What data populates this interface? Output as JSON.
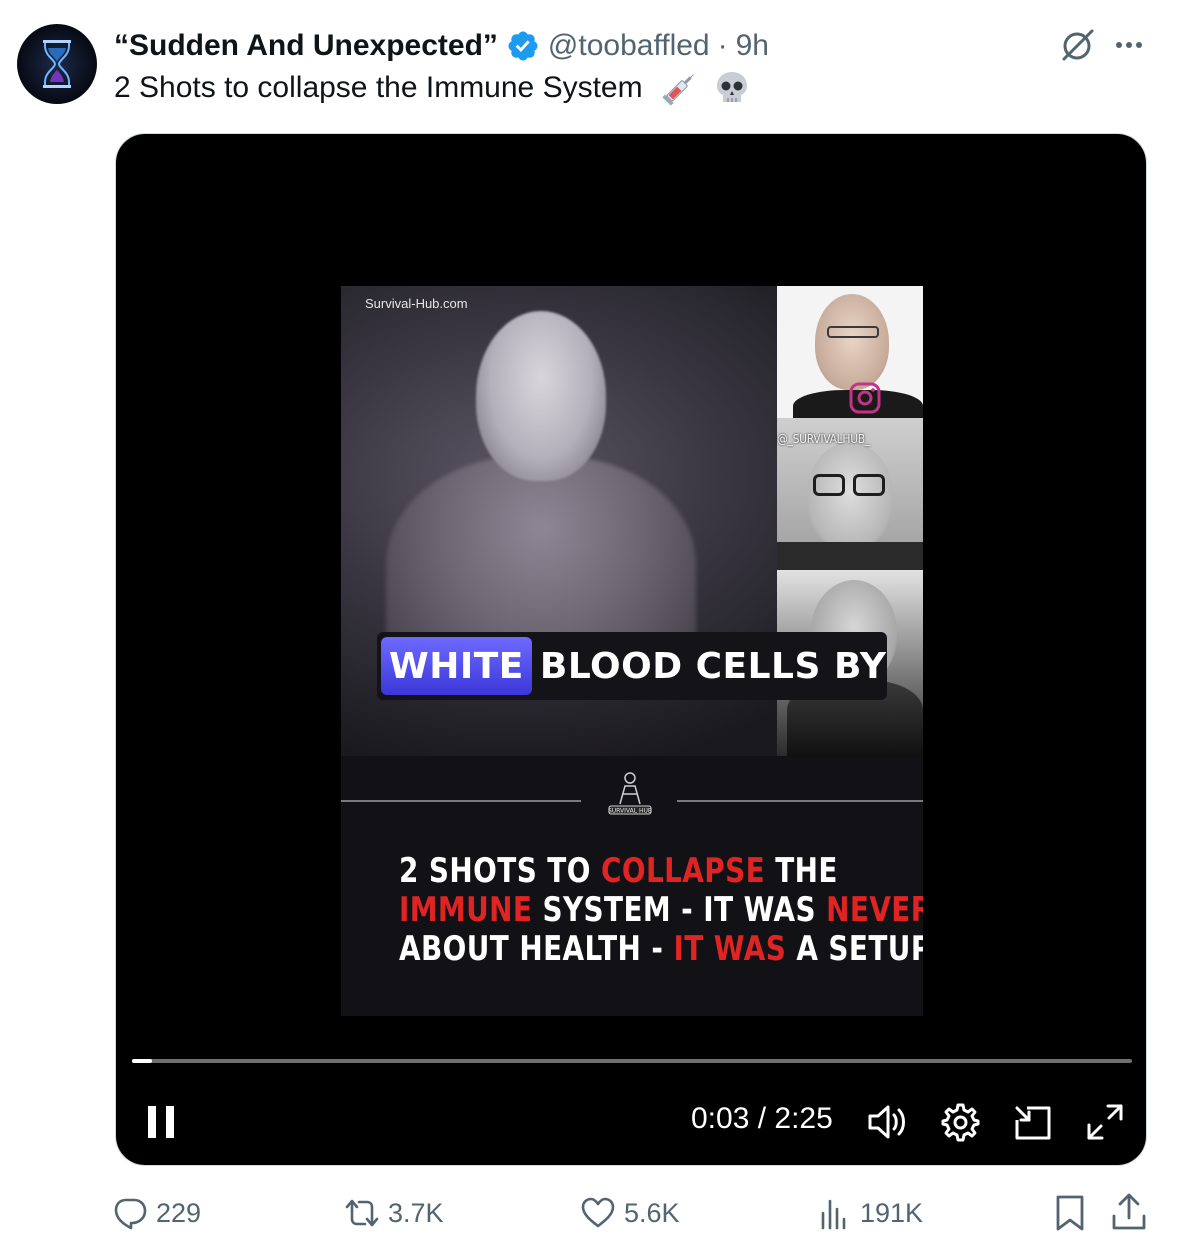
{
  "author": {
    "display_name": "“Sudden And Unexpected”",
    "handle": "@toobaffled",
    "separator": "·",
    "time_ago": "9h",
    "verified": true
  },
  "tweet": {
    "text": "2 Shots to collapse the Immune System",
    "emojis": [
      "syringe-emoji",
      "skull-emoji"
    ]
  },
  "video_frame": {
    "site_label": "Survival-Hub.com",
    "watermark": "@_SURVIVALHUB_",
    "caption_highlight": "WHITE",
    "caption_rest": "BLOOD CELLS BY",
    "logo_text": "SURVIVAL HUB",
    "headline": {
      "line1": [
        "2 SHOTS TO ",
        "COLLAPSE",
        " THE"
      ],
      "line2": [
        "IMMUNE",
        " SYSTEM - IT WAS ",
        "NEVER"
      ],
      "line3": [
        "ABOUT HEALTH - ",
        "IT WAS",
        " A SETUP"
      ]
    }
  },
  "player": {
    "current_time": "0:03",
    "duration": "2:25",
    "time_display": "0:03 / 2:25",
    "progress_fraction": 0.02,
    "state": "playing"
  },
  "actions": {
    "replies": "229",
    "reposts": "3.7K",
    "likes": "5.6K",
    "views": "191K"
  },
  "colors": {
    "accent_blue": "#1d9bf0",
    "text_primary": "#0f1419",
    "text_secondary": "#536471",
    "headline_red": "#e02424",
    "caption_highlight": "#4a46e6"
  }
}
